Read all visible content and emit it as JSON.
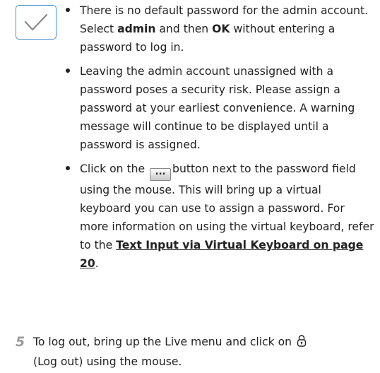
{
  "note": {
    "icon": "checkmark-icon",
    "accent_color": "#4a8fd0",
    "bullet1": {
      "part1": "There is no default password for the admin account. Select ",
      "bold1": "admin",
      "part2": " and then ",
      "bold2": "OK",
      "part3": " without entering a password to log in."
    },
    "bullet2": {
      "text": "Leaving the admin account unassigned with a password poses a security risk. Please assign a password at your earliest convenience. A warning message will continue to be displayed until a password is assigned."
    },
    "bullet3": {
      "part1": "Click on the ",
      "button_label": "...",
      "part2": "button next to the password field using the mouse. This will bring up a virtual keyboard you can use to assign a password. For more information on using the virtual keyboard, refer to the ",
      "link": "Text Input via Virtual Keyboard on page 20",
      "part3": "."
    }
  },
  "step": {
    "number": "5",
    "part1": "To log out, bring up the Live menu and click on ",
    "icon": "logout-lock-icon",
    "part2": "(Log out) using the mouse."
  }
}
